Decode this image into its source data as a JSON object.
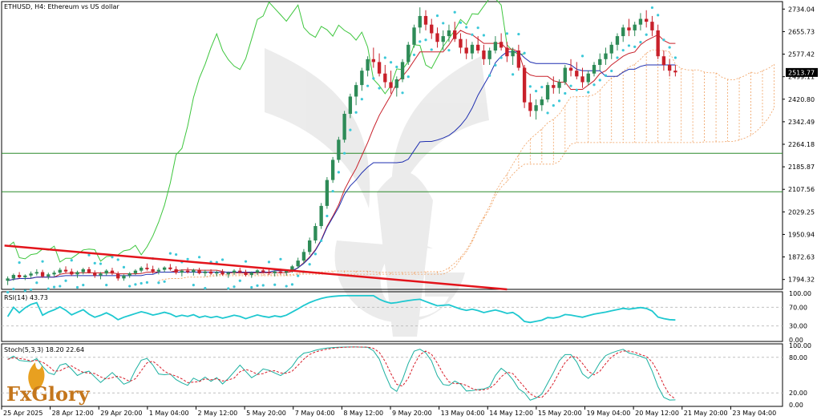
{
  "chart_data": {
    "type": "candlestick",
    "title": "ETHUSD, H4:  Ethereum vs US dollar",
    "current_price": "2513.77",
    "price_axis": {
      "ticks": [
        "2734.04",
        "2655.73",
        "2577.42",
        "2499.11",
        "2420.80",
        "2342.49",
        "2264.18",
        "2185.87",
        "2107.56",
        "2029.25",
        "1950.94",
        "1872.63",
        "1794.32"
      ],
      "range": [
        1760,
        2760
      ]
    },
    "x_axis": {
      "ticks": [
        "25 Apr 2025",
        "28 Apr 12:00",
        "29 Apr 20:00",
        "1 May 04:00",
        "2 May 12:00",
        "5 May 20:00",
        "7 May 04:00",
        "8 May 12:00",
        "9 May 20:00",
        "13 May 04:00",
        "14 May 12:00",
        "15 May 20:00",
        "19 May 04:00",
        "20 May 12:00",
        "21 May 20:00",
        "23 May 04:00"
      ]
    },
    "horizontal_levels": [
      2233,
      2099
    ],
    "trendline": {
      "from": [
        0,
        1912
      ],
      "to": [
        86,
        1760
      ]
    },
    "candles": [
      [
        1790,
        1805,
        1775,
        1798
      ],
      [
        1798,
        1815,
        1790,
        1810
      ],
      [
        1810,
        1820,
        1798,
        1802
      ],
      [
        1802,
        1812,
        1792,
        1808
      ],
      [
        1808,
        1822,
        1800,
        1815
      ],
      [
        1815,
        1830,
        1808,
        1820
      ],
      [
        1820,
        1828,
        1800,
        1805
      ],
      [
        1805,
        1818,
        1795,
        1812
      ],
      [
        1812,
        1825,
        1805,
        1818
      ],
      [
        1818,
        1835,
        1812,
        1828
      ],
      [
        1828,
        1840,
        1815,
        1822
      ],
      [
        1822,
        1832,
        1808,
        1812
      ],
      [
        1812,
        1825,
        1800,
        1820
      ],
      [
        1820,
        1835,
        1812,
        1830
      ],
      [
        1830,
        1838,
        1815,
        1818
      ],
      [
        1818,
        1826,
        1800,
        1808
      ],
      [
        1808,
        1820,
        1795,
        1815
      ],
      [
        1815,
        1830,
        1808,
        1825
      ],
      [
        1825,
        1835,
        1810,
        1815
      ],
      [
        1815,
        1822,
        1790,
        1798
      ],
      [
        1798,
        1812,
        1790,
        1808
      ],
      [
        1808,
        1820,
        1800,
        1816
      ],
      [
        1816,
        1830,
        1810,
        1825
      ],
      [
        1825,
        1840,
        1818,
        1835
      ],
      [
        1835,
        1850,
        1825,
        1830
      ],
      [
        1830,
        1842,
        1815,
        1822
      ],
      [
        1822,
        1835,
        1812,
        1828
      ],
      [
        1828,
        1840,
        1820,
        1836
      ],
      [
        1836,
        1848,
        1825,
        1830
      ],
      [
        1830,
        1840,
        1812,
        1818
      ],
      [
        1818,
        1830,
        1805,
        1825
      ],
      [
        1825,
        1836,
        1815,
        1820
      ],
      [
        1820,
        1832,
        1808,
        1828
      ],
      [
        1828,
        1835,
        1812,
        1816
      ],
      [
        1816,
        1828,
        1805,
        1822
      ],
      [
        1822,
        1830,
        1810,
        1815
      ],
      [
        1815,
        1825,
        1805,
        1820
      ],
      [
        1820,
        1830,
        1808,
        1812
      ],
      [
        1812,
        1822,
        1800,
        1818
      ],
      [
        1818,
        1830,
        1810,
        1825
      ],
      [
        1825,
        1835,
        1815,
        1820
      ],
      [
        1820,
        1828,
        1805,
        1810
      ],
      [
        1810,
        1822,
        1800,
        1818
      ],
      [
        1818,
        1830,
        1810,
        1826
      ],
      [
        1826,
        1836,
        1815,
        1820
      ],
      [
        1820,
        1830,
        1810,
        1816
      ],
      [
        1816,
        1826,
        1805,
        1822
      ],
      [
        1822,
        1832,
        1812,
        1818
      ],
      [
        1818,
        1828,
        1808,
        1825
      ],
      [
        1825,
        1845,
        1818,
        1840
      ],
      [
        1840,
        1870,
        1832,
        1860
      ],
      [
        1860,
        1900,
        1850,
        1890
      ],
      [
        1890,
        1940,
        1880,
        1930
      ],
      [
        1930,
        1990,
        1920,
        1980
      ],
      [
        1980,
        2060,
        1970,
        2050
      ],
      [
        2050,
        2150,
        2040,
        2140
      ],
      [
        2140,
        2220,
        2130,
        2210
      ],
      [
        2210,
        2290,
        2200,
        2280
      ],
      [
        2280,
        2380,
        2270,
        2370
      ],
      [
        2370,
        2440,
        2355,
        2430
      ],
      [
        2430,
        2480,
        2400,
        2470
      ],
      [
        2470,
        2530,
        2450,
        2520
      ],
      [
        2520,
        2570,
        2500,
        2560
      ],
      [
        2560,
        2600,
        2530,
        2550
      ],
      [
        2550,
        2580,
        2500,
        2510
      ],
      [
        2510,
        2540,
        2460,
        2480
      ],
      [
        2480,
        2520,
        2440,
        2460
      ],
      [
        2460,
        2500,
        2430,
        2490
      ],
      [
        2490,
        2560,
        2480,
        2550
      ],
      [
        2550,
        2620,
        2540,
        2610
      ],
      [
        2610,
        2680,
        2600,
        2670
      ],
      [
        2670,
        2740,
        2650,
        2710
      ],
      [
        2710,
        2730,
        2660,
        2680
      ],
      [
        2680,
        2700,
        2630,
        2650
      ],
      [
        2650,
        2670,
        2600,
        2620
      ],
      [
        2620,
        2660,
        2590,
        2640
      ],
      [
        2640,
        2680,
        2620,
        2660
      ],
      [
        2660,
        2690,
        2620,
        2630
      ],
      [
        2630,
        2650,
        2580,
        2600
      ],
      [
        2600,
        2630,
        2560,
        2580
      ],
      [
        2580,
        2620,
        2560,
        2610
      ],
      [
        2610,
        2640,
        2580,
        2590
      ],
      [
        2590,
        2610,
        2540,
        2560
      ],
      [
        2560,
        2600,
        2540,
        2590
      ],
      [
        2590,
        2640,
        2580,
        2620
      ],
      [
        2620,
        2650,
        2590,
        2600
      ],
      [
        2600,
        2620,
        2550,
        2570
      ],
      [
        2570,
        2600,
        2540,
        2590
      ],
      [
        2590,
        2610,
        2520,
        2530
      ],
      [
        2530,
        2540,
        2390,
        2410
      ],
      [
        2410,
        2440,
        2360,
        2380
      ],
      [
        2380,
        2420,
        2350,
        2400
      ],
      [
        2400,
        2430,
        2380,
        2420
      ],
      [
        2420,
        2480,
        2410,
        2470
      ],
      [
        2470,
        2500,
        2440,
        2460
      ],
      [
        2460,
        2490,
        2440,
        2480
      ],
      [
        2480,
        2540,
        2470,
        2530
      ],
      [
        2530,
        2560,
        2500,
        2520
      ],
      [
        2520,
        2550,
        2490,
        2500
      ],
      [
        2500,
        2530,
        2460,
        2480
      ],
      [
        2480,
        2520,
        2470,
        2510
      ],
      [
        2510,
        2550,
        2500,
        2540
      ],
      [
        2540,
        2580,
        2520,
        2560
      ],
      [
        2560,
        2600,
        2540,
        2580
      ],
      [
        2580,
        2620,
        2560,
        2610
      ],
      [
        2610,
        2650,
        2590,
        2640
      ],
      [
        2640,
        2680,
        2620,
        2670
      ],
      [
        2670,
        2700,
        2640,
        2660
      ],
      [
        2660,
        2690,
        2640,
        2680
      ],
      [
        2680,
        2720,
        2660,
        2700
      ],
      [
        2700,
        2730,
        2670,
        2690
      ],
      [
        2690,
        2710,
        2640,
        2660
      ],
      [
        2660,
        2680,
        2560,
        2570
      ],
      [
        2570,
        2590,
        2520,
        2540
      ],
      [
        2540,
        2560,
        2500,
        2520
      ],
      [
        2520,
        2540,
        2500,
        2514
      ]
    ],
    "indicators": [
      {
        "label": "RSI(14) 43.73",
        "levels": [
          "100.00",
          "70.00",
          "30.00",
          "0.00"
        ],
        "dashed": [
          70,
          30
        ]
      },
      {
        "label": "Stoch(5,3,3) 18.20 22.64",
        "levels": [
          "100.00",
          "80.00",
          "20.00",
          "0.00"
        ],
        "dashed": [
          80,
          20
        ]
      }
    ]
  },
  "branding": {
    "logo": "FxGlory"
  },
  "colors": {
    "up": "#2e8b57",
    "down": "#c8202a",
    "trend": "#e3141b",
    "psar": "#3cc8d8",
    "tenkan": "#c8202a",
    "kijun": "#1f2fb0",
    "chikou": "#3ec63e",
    "cloud": "#f0a060",
    "rsi": "#1ec8d0",
    "stoch_main": "#1ab0a0",
    "stoch_signal": "#d81e2a",
    "level": "#2b8a2b"
  }
}
